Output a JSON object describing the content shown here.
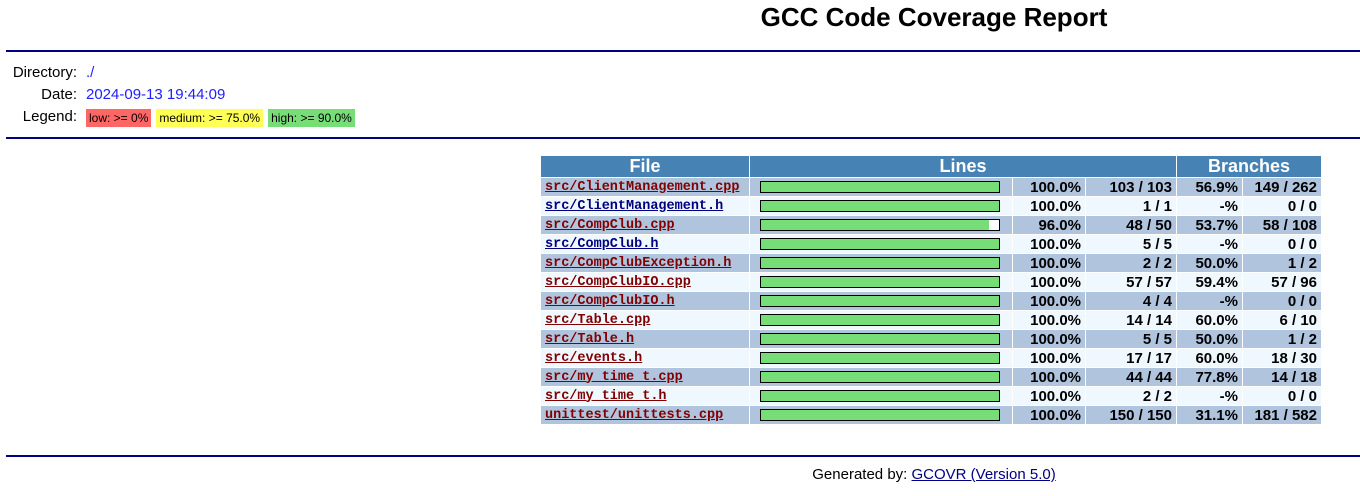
{
  "title": "GCC Code Coverage Report",
  "info": {
    "directory_label": "Directory:",
    "directory_value": "./",
    "date_label": "Date:",
    "date_value": "2024-09-13 19:44:09",
    "legend_label": "Legend:",
    "legend": {
      "low": "low: >= 0%",
      "medium": "medium: >= 75.0%",
      "high": "high: >= 90.0%"
    }
  },
  "table": {
    "headers": {
      "file": "File",
      "lines": "Lines",
      "branches": "Branches"
    },
    "rows": [
      {
        "file": "src/ClientManagement.cpp",
        "visited": false,
        "line_pct": "100.0%",
        "line_frac": "103 / 103",
        "line_fill": 1.0,
        "branch_pct": "56.9%",
        "branch_frac": "149 / 262"
      },
      {
        "file": "src/ClientManagement.h",
        "visited": true,
        "line_pct": "100.0%",
        "line_frac": "1 / 1",
        "line_fill": 1.0,
        "branch_pct": "-%",
        "branch_frac": "0 / 0"
      },
      {
        "file": "src/CompClub.cpp",
        "visited": false,
        "line_pct": "96.0%",
        "line_frac": "48 / 50",
        "line_fill": 0.96,
        "branch_pct": "53.7%",
        "branch_frac": "58 / 108"
      },
      {
        "file": "src/CompClub.h",
        "visited": true,
        "line_pct": "100.0%",
        "line_frac": "5 / 5",
        "line_fill": 1.0,
        "branch_pct": "-%",
        "branch_frac": "0 / 0"
      },
      {
        "file": "src/CompClubException.h",
        "visited": false,
        "line_pct": "100.0%",
        "line_frac": "2 / 2",
        "line_fill": 1.0,
        "branch_pct": "50.0%",
        "branch_frac": "1 / 2"
      },
      {
        "file": "src/CompClubIO.cpp",
        "visited": false,
        "line_pct": "100.0%",
        "line_frac": "57 / 57",
        "line_fill": 1.0,
        "branch_pct": "59.4%",
        "branch_frac": "57 / 96"
      },
      {
        "file": "src/CompClubIO.h",
        "visited": false,
        "line_pct": "100.0%",
        "line_frac": "4 / 4",
        "line_fill": 1.0,
        "branch_pct": "-%",
        "branch_frac": "0 / 0"
      },
      {
        "file": "src/Table.cpp",
        "visited": false,
        "line_pct": "100.0%",
        "line_frac": "14 / 14",
        "line_fill": 1.0,
        "branch_pct": "60.0%",
        "branch_frac": "6 / 10"
      },
      {
        "file": "src/Table.h",
        "visited": false,
        "line_pct": "100.0%",
        "line_frac": "5 / 5",
        "line_fill": 1.0,
        "branch_pct": "50.0%",
        "branch_frac": "1 / 2"
      },
      {
        "file": "src/events.h",
        "visited": false,
        "line_pct": "100.0%",
        "line_frac": "17 / 17",
        "line_fill": 1.0,
        "branch_pct": "60.0%",
        "branch_frac": "18 / 30"
      },
      {
        "file": "src/my_time_t.cpp",
        "visited": false,
        "line_pct": "100.0%",
        "line_frac": "44 / 44",
        "line_fill": 1.0,
        "branch_pct": "77.8%",
        "branch_frac": "14 / 18"
      },
      {
        "file": "src/my_time_t.h",
        "visited": false,
        "line_pct": "100.0%",
        "line_frac": "2 / 2",
        "line_fill": 1.0,
        "branch_pct": "-%",
        "branch_frac": "0 / 0"
      },
      {
        "file": "unittest/unittests.cpp",
        "visited": false,
        "line_pct": "100.0%",
        "line_frac": "150 / 150",
        "line_fill": 1.0,
        "branch_pct": "31.1%",
        "branch_frac": "181 / 582"
      }
    ]
  },
  "footer": {
    "label": "Generated by:",
    "link": "GCOVR (Version 5.0)"
  },
  "colors": {
    "header_bg": "#4682b4",
    "row_odd": "#b0c4de",
    "row_even": "#f0f8ff",
    "bar_fill": "#77dd77",
    "rule": "#000080"
  }
}
